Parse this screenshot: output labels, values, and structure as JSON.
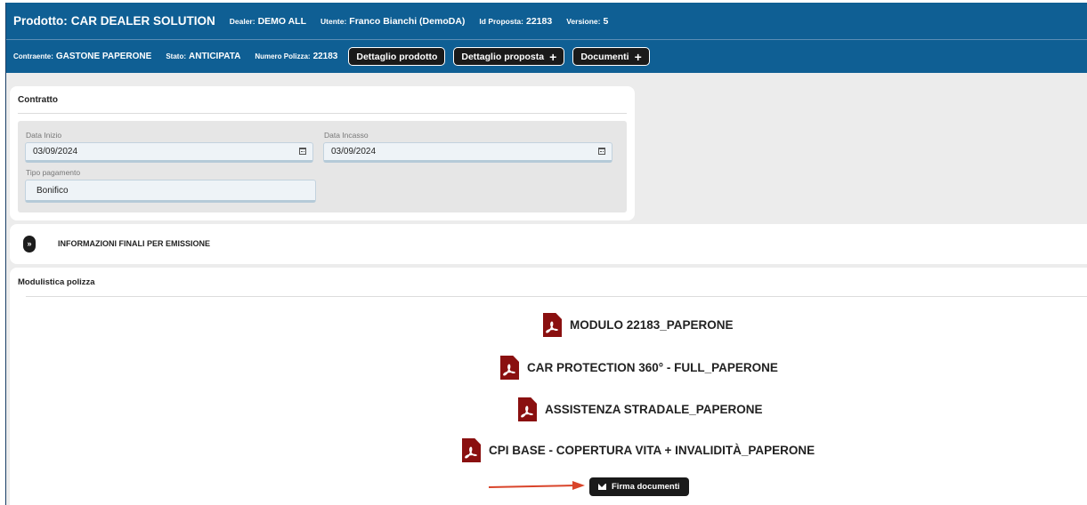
{
  "header": {
    "product_label": "Prodotto:",
    "product_value": "CAR DEALER SOLUTION",
    "dealer_label": "Dealer:",
    "dealer_value": "DEMO ALL",
    "user_label": "Utente:",
    "user_value": "Franco Bianchi (DemoDA)",
    "proposal_label": "Id Proposta:",
    "proposal_value": "22183",
    "version_label": "Versione:",
    "version_value": "5"
  },
  "subheader": {
    "contractor_label": "Contraente:",
    "contractor_value": "GASTONE PAPERONE",
    "state_label": "Stato:",
    "state_value": "ANTICIPATA",
    "policy_label": "Numero Polizza:",
    "policy_value": "22183",
    "btn_product": "Dettaglio prodotto",
    "btn_proposal": "Dettaglio proposta",
    "btn_documents": "Documenti"
  },
  "contract": {
    "title": "Contratto",
    "start_label": "Data Inizio",
    "start_value": "03/09/2024",
    "collect_label": "Data Incasso",
    "collect_value": "03/09/2024",
    "payment_label": "Tipo pagamento",
    "payment_value": "Bonifico"
  },
  "final_info": {
    "title": "INFORMAZIONI FINALI PER EMISSIONE"
  },
  "forms": {
    "title": "Modulistica polizza",
    "documents": [
      "MODULO 22183_PAPERONE",
      "CAR PROTECTION 360° - FULL_PAPERONE",
      "ASSISTENZA STRADALE_PAPERONE",
      "CPI BASE - COPERTURA VITA + INVALIDITÀ_PAPERONE"
    ],
    "sign_button": "Firma documenti"
  },
  "colors": {
    "header_bg": "#0f5f94",
    "pdf_icon": "#8a1010",
    "arrow": "#d9442a"
  }
}
